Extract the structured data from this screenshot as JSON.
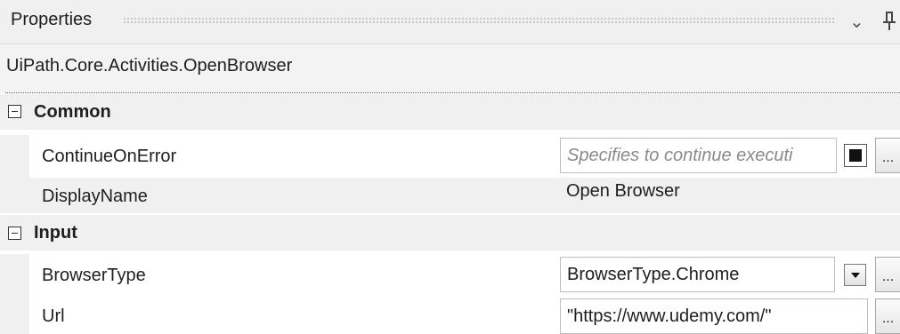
{
  "panel": {
    "title": "Properties",
    "object_name": "UiPath.Core.Activities.OpenBrowser"
  },
  "icons": {
    "dropdown": "chevron-down-icon",
    "pin": "pin-icon",
    "collapse": "collapse-minus-icon",
    "browse": "ellipsis-icon"
  },
  "categories": [
    {
      "label": "Common",
      "properties": [
        {
          "name": "ContinueOnError",
          "placeholder": "Specifies to continue executi",
          "checkbox_checked": true,
          "browse_label": "..."
        },
        {
          "name": "DisplayName",
          "value": "Open Browser"
        }
      ]
    },
    {
      "label": "Input",
      "properties": [
        {
          "name": "BrowserType",
          "value": "BrowserType.Chrome",
          "browse_label": "..."
        },
        {
          "name": "Url",
          "value": "\"https://www.udemy.com/\"",
          "browse_label": "..."
        }
      ]
    }
  ]
}
